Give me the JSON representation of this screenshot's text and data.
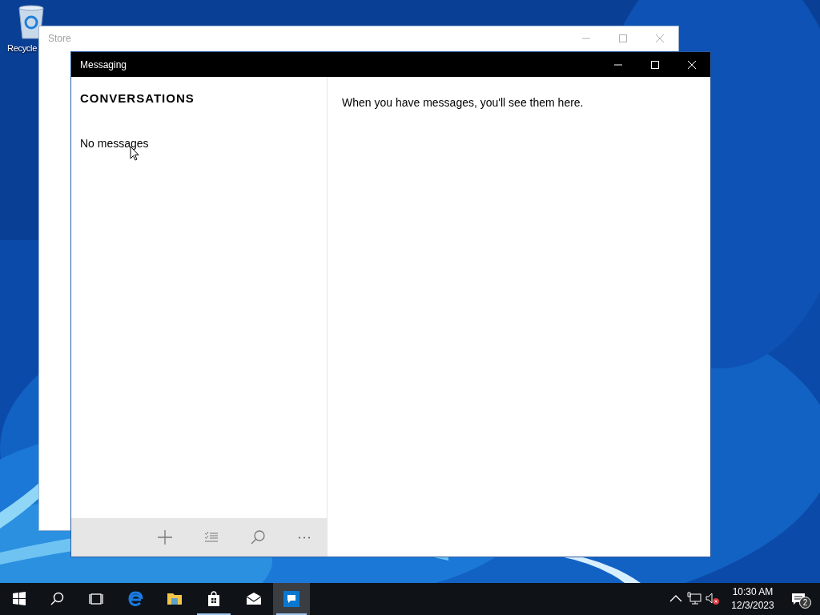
{
  "desktop_icons": [
    {
      "label": "Recycle"
    }
  ],
  "store_window": {
    "title": "Store"
  },
  "messaging_window": {
    "title": "Messaging",
    "sidebar": {
      "heading": "CONVERSATIONS",
      "empty_text": "No messages"
    },
    "toolbar": [
      {
        "kind": "add"
      },
      {
        "kind": "select"
      },
      {
        "kind": "search"
      },
      {
        "kind": "more"
      }
    ],
    "main": {
      "empty_text": "When you have messages, you'll see them here."
    }
  },
  "taskbar": {
    "items": [
      {
        "kind": "start",
        "running": false,
        "selected": false
      },
      {
        "kind": "search",
        "running": false,
        "selected": false
      },
      {
        "kind": "taskview",
        "running": false,
        "selected": false
      },
      {
        "kind": "edge",
        "running": false,
        "selected": false
      },
      {
        "kind": "explorer",
        "running": false,
        "selected": false
      },
      {
        "kind": "store",
        "running": true,
        "selected": false
      },
      {
        "kind": "mail",
        "running": false,
        "selected": false
      },
      {
        "kind": "messaging",
        "running": true,
        "selected": true
      }
    ],
    "tray": {
      "time": "10:30 AM",
      "date": "12/3/2023",
      "notification_count": "2"
    }
  }
}
